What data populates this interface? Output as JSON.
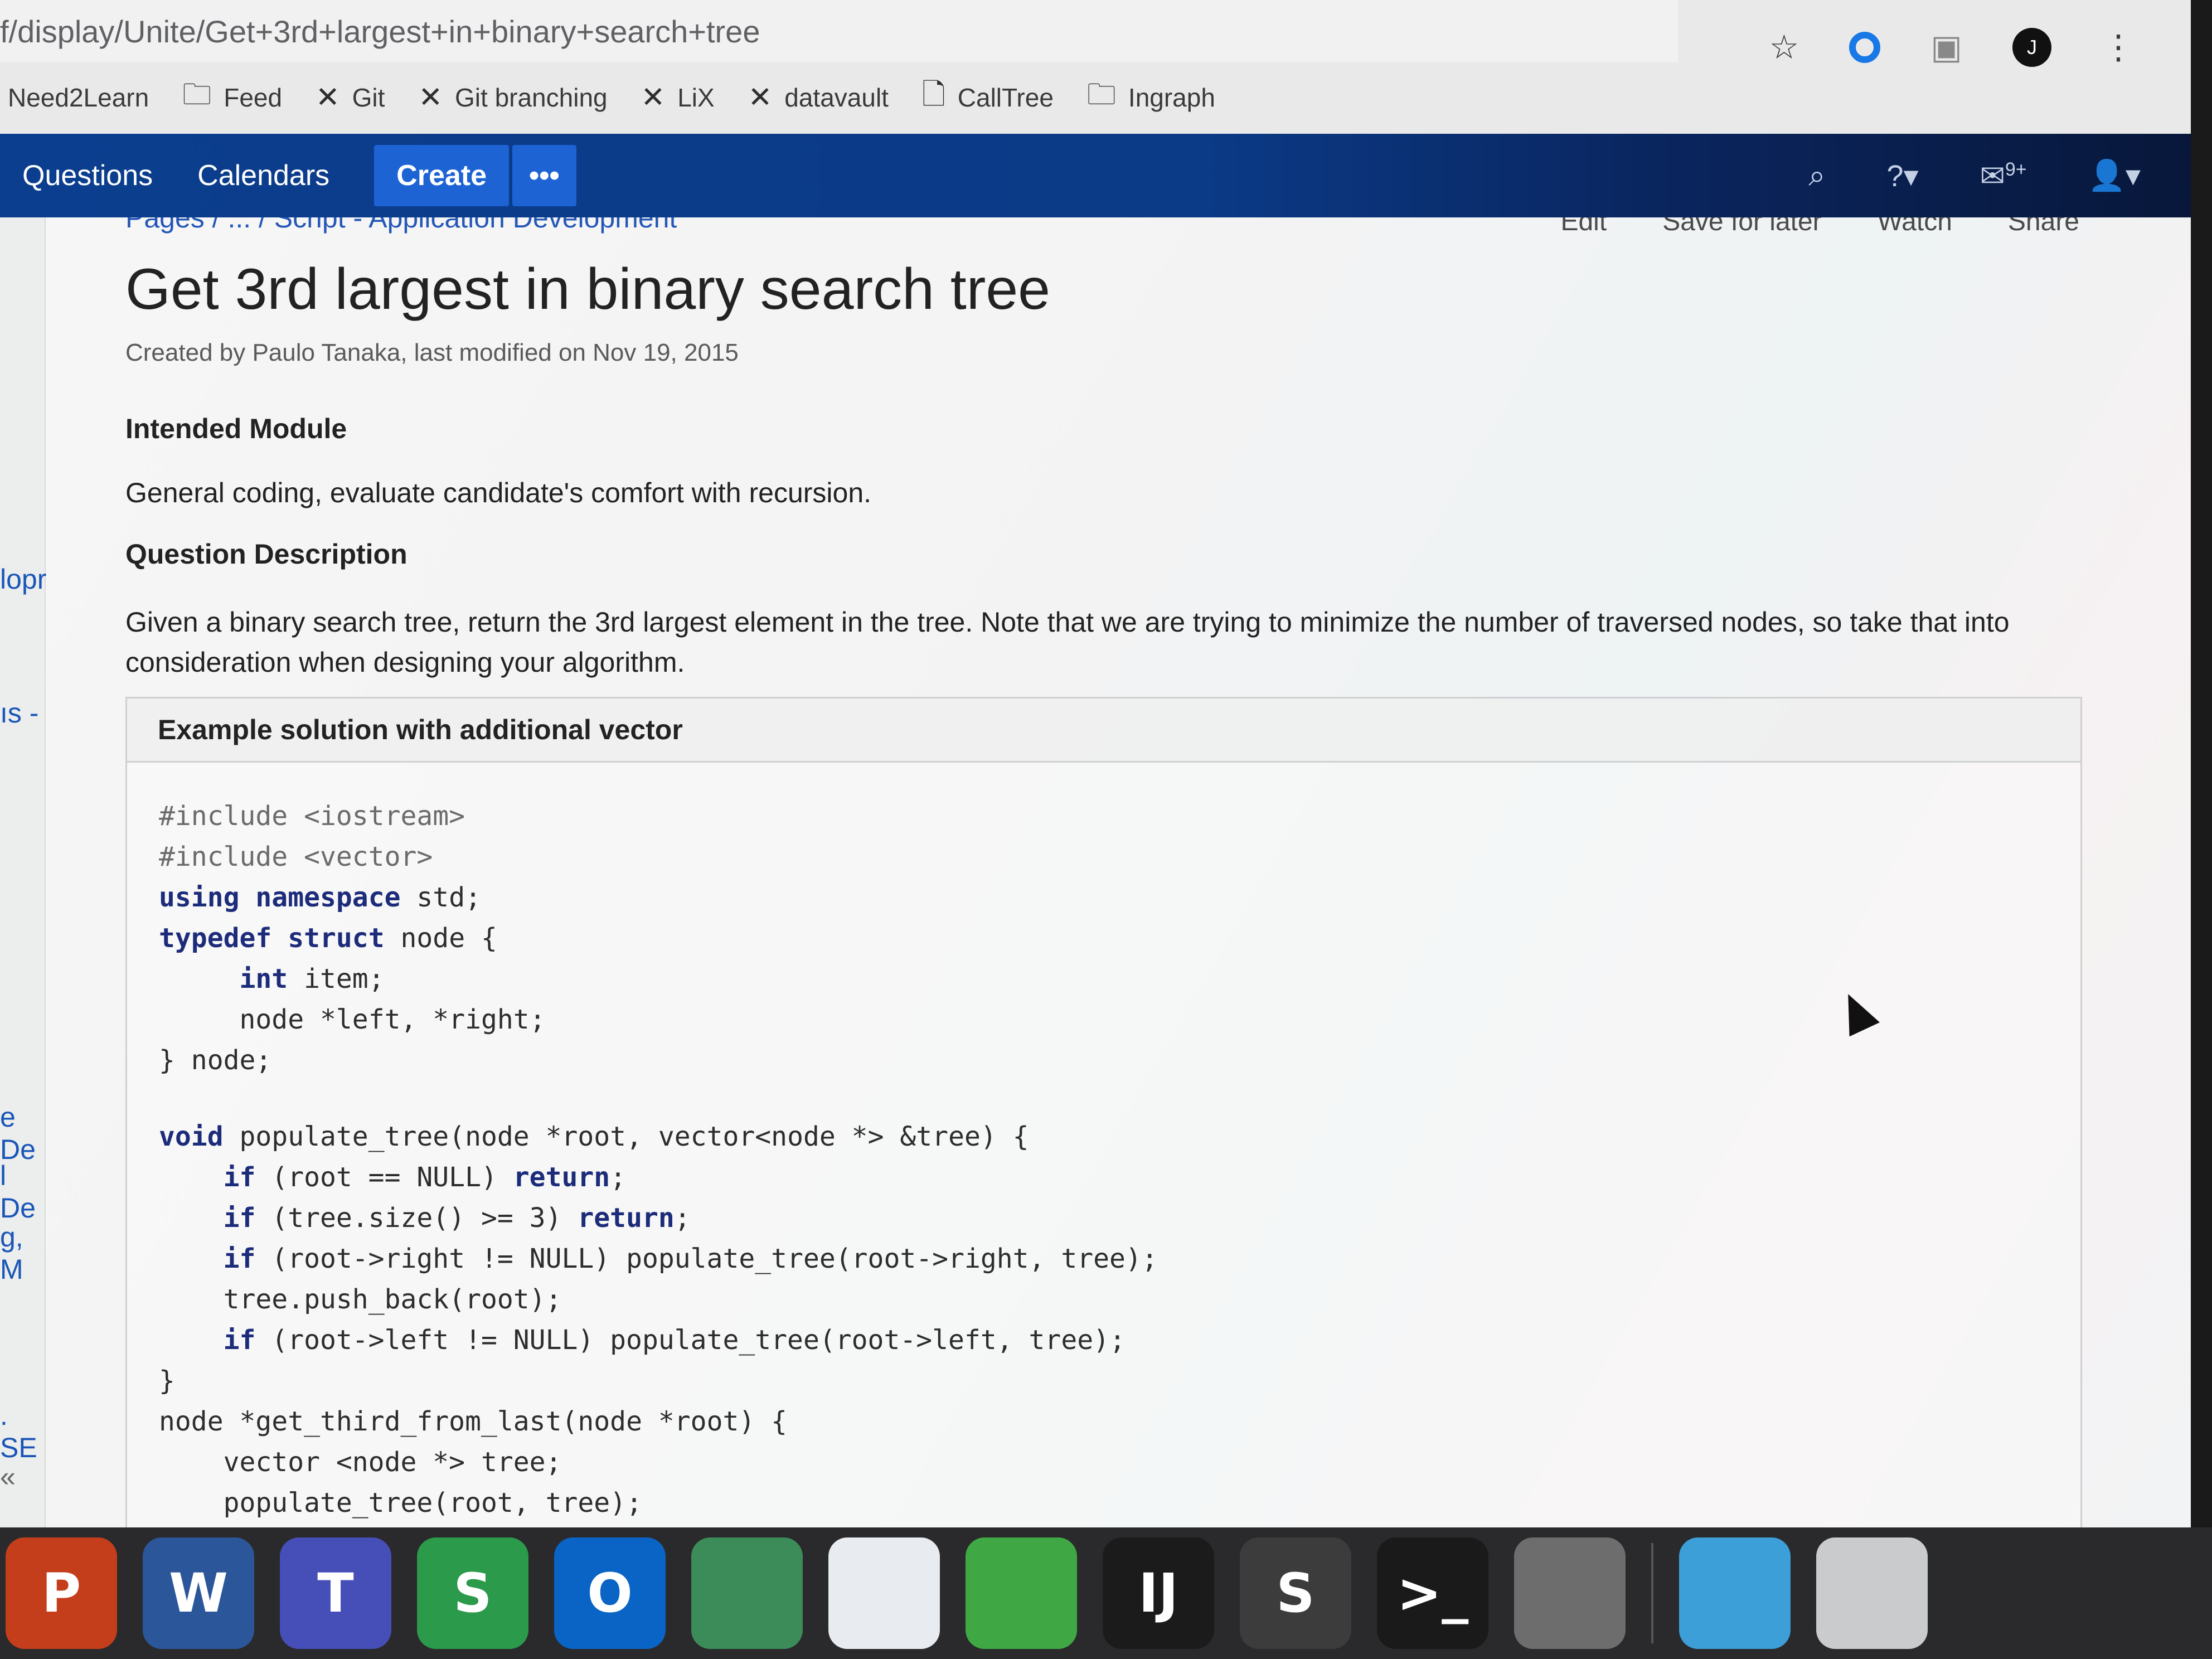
{
  "browser": {
    "url": "f/display/Unite/Get+3rd+largest+in+binary+search+tree",
    "profile_initial": "J",
    "bookmarks": [
      {
        "label": "Need2Learn",
        "icon": "none"
      },
      {
        "label": "Feed",
        "icon": "folder-icon"
      },
      {
        "label": "Git",
        "icon": "confluence-icon"
      },
      {
        "label": "Git branching",
        "icon": "confluence-icon"
      },
      {
        "label": "LiX",
        "icon": "confluence-icon"
      },
      {
        "label": "datavault",
        "icon": "confluence-icon"
      },
      {
        "label": "CallTree",
        "icon": "page-icon"
      },
      {
        "label": "Ingraph",
        "icon": "folder-icon"
      }
    ]
  },
  "nav": {
    "questions": "Questions",
    "calendars": "Calendars",
    "create": "Create",
    "more": "•••",
    "notifications_badge": "9+"
  },
  "breadcrumb": {
    "text": "Pages / ... / Script - Application Development"
  },
  "page_actions": [
    "Edit",
    "Save for later",
    "Watch",
    "Share"
  ],
  "page": {
    "title": "Get 3rd largest in binary search tree",
    "byline": "Created by Paulo Tanaka, last modified on Nov 19, 2015",
    "intended_module_heading": "Intended Module",
    "intended_module_text": "General coding, evaluate candidate's comfort with recursion.",
    "question_heading": "Question Description",
    "question_text": "Given a binary search tree, return the 3rd largest element in the tree. Note that we are trying to minimize the number of traversed nodes, so take that into consideration when designing your algorithm."
  },
  "code_panel": {
    "title": "Example solution with additional vector",
    "lines": [
      "#include <iostream>",
      "#include <vector>",
      "using namespace std;",
      "typedef struct node {",
      "     int item;",
      "     node *left, *right;",
      "} node;",
      "",
      "void populate_tree(node *root, vector<node *> &tree) {",
      "    if (root == NULL) return;",
      "    if (tree.size() >= 3) return;",
      "    if (root->right != NULL) populate_tree(root->right, tree);",
      "    tree.push_back(root);",
      "    if (root->left != NULL) populate_tree(root->left, tree);",
      "}",
      "node *get_third_from_last(node *root) {",
      "    vector <node *> tree;",
      "    populate_tree(root, tree);"
    ]
  },
  "sidebar_fragments": [
    "e",
    "lopr",
    "ıs -",
    "e De",
    "l De",
    "g, M",
    ". SE",
    "«"
  ],
  "dock": [
    {
      "name": "powerpoint",
      "label": "P",
      "color": "#c43e1c"
    },
    {
      "name": "word",
      "label": "W",
      "color": "#2b579a"
    },
    {
      "name": "teams",
      "label": "T",
      "color": "#464eb8"
    },
    {
      "name": "slack-like",
      "label": "S",
      "color": "#2b9a4a"
    },
    {
      "name": "outlook",
      "label": "O",
      "color": "#0a64c6"
    },
    {
      "name": "network",
      "label": "",
      "color": "#3c8c5a"
    },
    {
      "name": "wifi",
      "label": "",
      "color": "#e8ecf0"
    },
    {
      "name": "colorful",
      "label": "",
      "color": "#3fa844"
    },
    {
      "name": "intellij",
      "label": "IJ",
      "color": "#1b1b1b"
    },
    {
      "name": "sublime",
      "label": "S",
      "color": "#3c3c3c"
    },
    {
      "name": "terminal",
      "label": ">_",
      "color": "#1a1a1a"
    },
    {
      "name": "system-preferences",
      "label": "",
      "color": "#6d6d6d"
    },
    {
      "name": "downloads",
      "label": "",
      "color": "#3c9fd8"
    },
    {
      "name": "trash",
      "label": "",
      "color": "#c9cbcd"
    }
  ]
}
